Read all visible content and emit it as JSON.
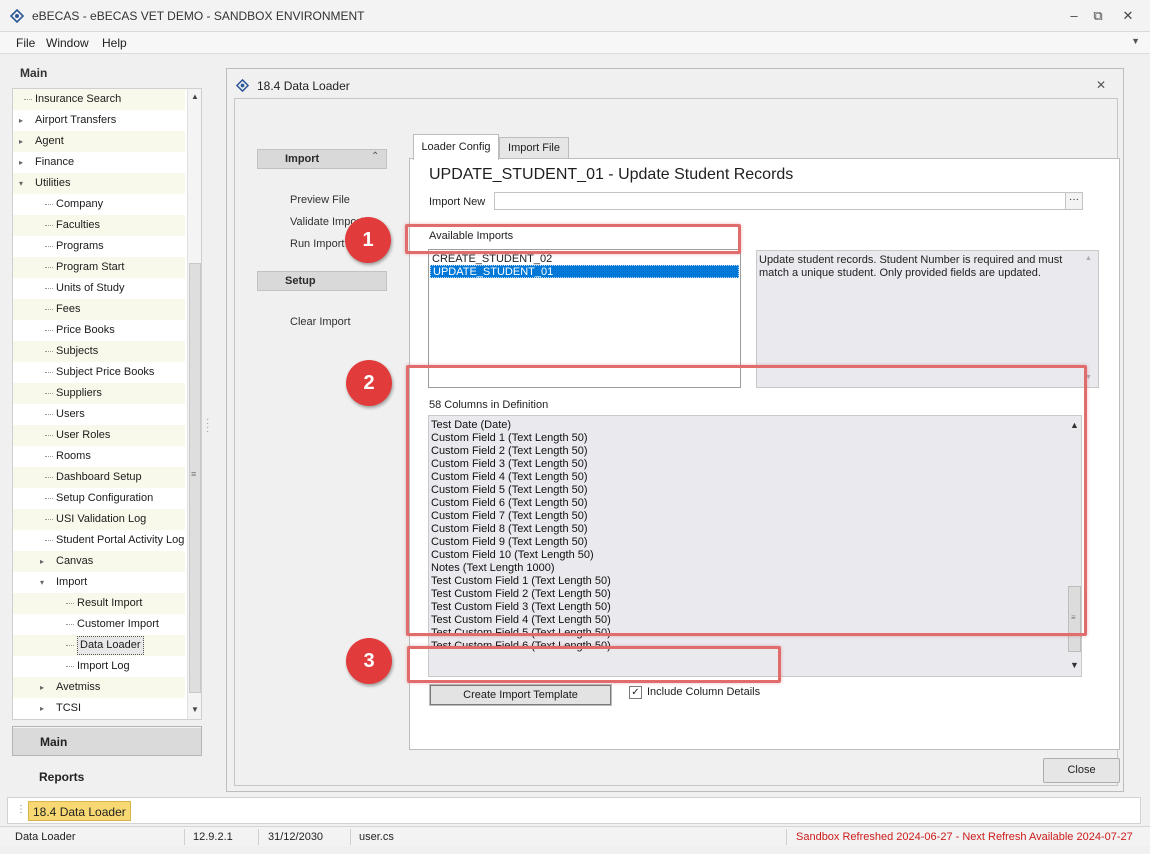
{
  "window": {
    "title": "eBECAS - eBECAS VET DEMO - SANDBOX ENVIRONMENT",
    "minimize_icon": "minimize-icon",
    "restore_icon": "restore-icon",
    "close_icon": "close-icon"
  },
  "menubar": {
    "items": [
      "File",
      "Window",
      "Help"
    ]
  },
  "nav": {
    "heading": "Main",
    "tree": [
      {
        "label": "Insurance Search",
        "level": 1
      },
      {
        "label": "Airport Transfers",
        "level": 1,
        "expander": "▸"
      },
      {
        "label": "Agent",
        "level": 1,
        "expander": "▸"
      },
      {
        "label": "Finance",
        "level": 1,
        "expander": "▸"
      },
      {
        "label": "Utilities",
        "level": 1,
        "expander": "▾"
      },
      {
        "label": "Company",
        "level": 2
      },
      {
        "label": "Faculties",
        "level": 2
      },
      {
        "label": "Programs",
        "level": 2
      },
      {
        "label": "Program Start",
        "level": 2
      },
      {
        "label": "Units of Study",
        "level": 2
      },
      {
        "label": "Fees",
        "level": 2
      },
      {
        "label": "Price Books",
        "level": 2
      },
      {
        "label": "Subjects",
        "level": 2
      },
      {
        "label": "Subject Price Books",
        "level": 2
      },
      {
        "label": "Suppliers",
        "level": 2
      },
      {
        "label": "Users",
        "level": 2
      },
      {
        "label": "User Roles",
        "level": 2
      },
      {
        "label": "Rooms",
        "level": 2
      },
      {
        "label": "Dashboard Setup",
        "level": 2
      },
      {
        "label": "Setup Configuration",
        "level": 2
      },
      {
        "label": "USI Validation Log",
        "level": 2
      },
      {
        "label": "Student Portal Activity Log",
        "level": 2
      },
      {
        "label": "Canvas",
        "level": 2,
        "expander": "▸"
      },
      {
        "label": "Import",
        "level": 2,
        "expander": "▾"
      },
      {
        "label": "Result Import",
        "level": 3
      },
      {
        "label": "Customer Import",
        "level": 3
      },
      {
        "label": "Data Loader",
        "level": 3,
        "selected": true
      },
      {
        "label": "Import Log",
        "level": 3
      },
      {
        "label": "Avetmiss",
        "level": 2,
        "expander": "▸"
      },
      {
        "label": "TCSI",
        "level": 2,
        "expander": "▸"
      }
    ],
    "groups": {
      "main": "Main",
      "reports": "Reports"
    }
  },
  "dialog": {
    "title": "18.4 Data Loader",
    "side": {
      "import_section": "Import",
      "import_links": [
        "Preview File",
        "Validate Import",
        "Run Import"
      ],
      "setup_section": "Setup",
      "setup_links": [
        "Clear Import"
      ]
    },
    "tabs": [
      "Loader Config",
      "Import File"
    ],
    "definition_title": "UPDATE_STUDENT_01 - Update Student Records",
    "import_new_label": "Import New",
    "import_new_value": "",
    "browse_label": "···",
    "available_label": "Available Imports",
    "imports": [
      "CREATE_STUDENT_02",
      "UPDATE_STUDENT_01"
    ],
    "selected_import": "UPDATE_STUDENT_01",
    "description": "Update student records. Student Number is required and must match a unique student. Only provided fields are updated.",
    "columns_label": "58 Columns in Definition",
    "columns": [
      "Test Date (Date)",
      "Custom Field 1 (Text Length 50)",
      "Custom Field 2 (Text Length 50)",
      "Custom Field 3 (Text Length 50)",
      "Custom Field 4 (Text Length 50)",
      "Custom Field 5 (Text Length 50)",
      "Custom Field 6 (Text Length 50)",
      "Custom Field 7 (Text Length 50)",
      "Custom Field 8 (Text Length 50)",
      "Custom Field 9 (Text Length 50)",
      "Custom Field 10 (Text Length 50)",
      "Notes (Text Length 1000)",
      "Test Custom Field 1 (Text Length 50)",
      "Test Custom Field 2 (Text Length 50)",
      "Test Custom Field 3 (Text Length 50)",
      "Test Custom Field 4 (Text Length 50)",
      "Test Custom Field 5 (Text Length 50)",
      "Test Custom Field 6 (Text Length 50)"
    ],
    "template_button": "Create Import Template",
    "include_details_label": "Include Column Details",
    "include_details_checked": true,
    "check_mark": "✓",
    "close_button": "Close"
  },
  "callouts": [
    "1",
    "2",
    "3"
  ],
  "taskbar": {
    "open_tab": "18.4 Data Loader"
  },
  "status": {
    "screen": "Data Loader",
    "version": "12.9.2.1",
    "date": "31/12/2030",
    "user": "user.cs",
    "sandbox": "Sandbox Refreshed 2024-06-27 - Next Refresh Available 2024-07-27"
  },
  "colors": {
    "accent_selection": "#0078d7",
    "callout": "#e23b3b",
    "highlight": "#e06c6c",
    "sandbox_text": "#cc1b1b",
    "open_tab": "#f7d872"
  }
}
